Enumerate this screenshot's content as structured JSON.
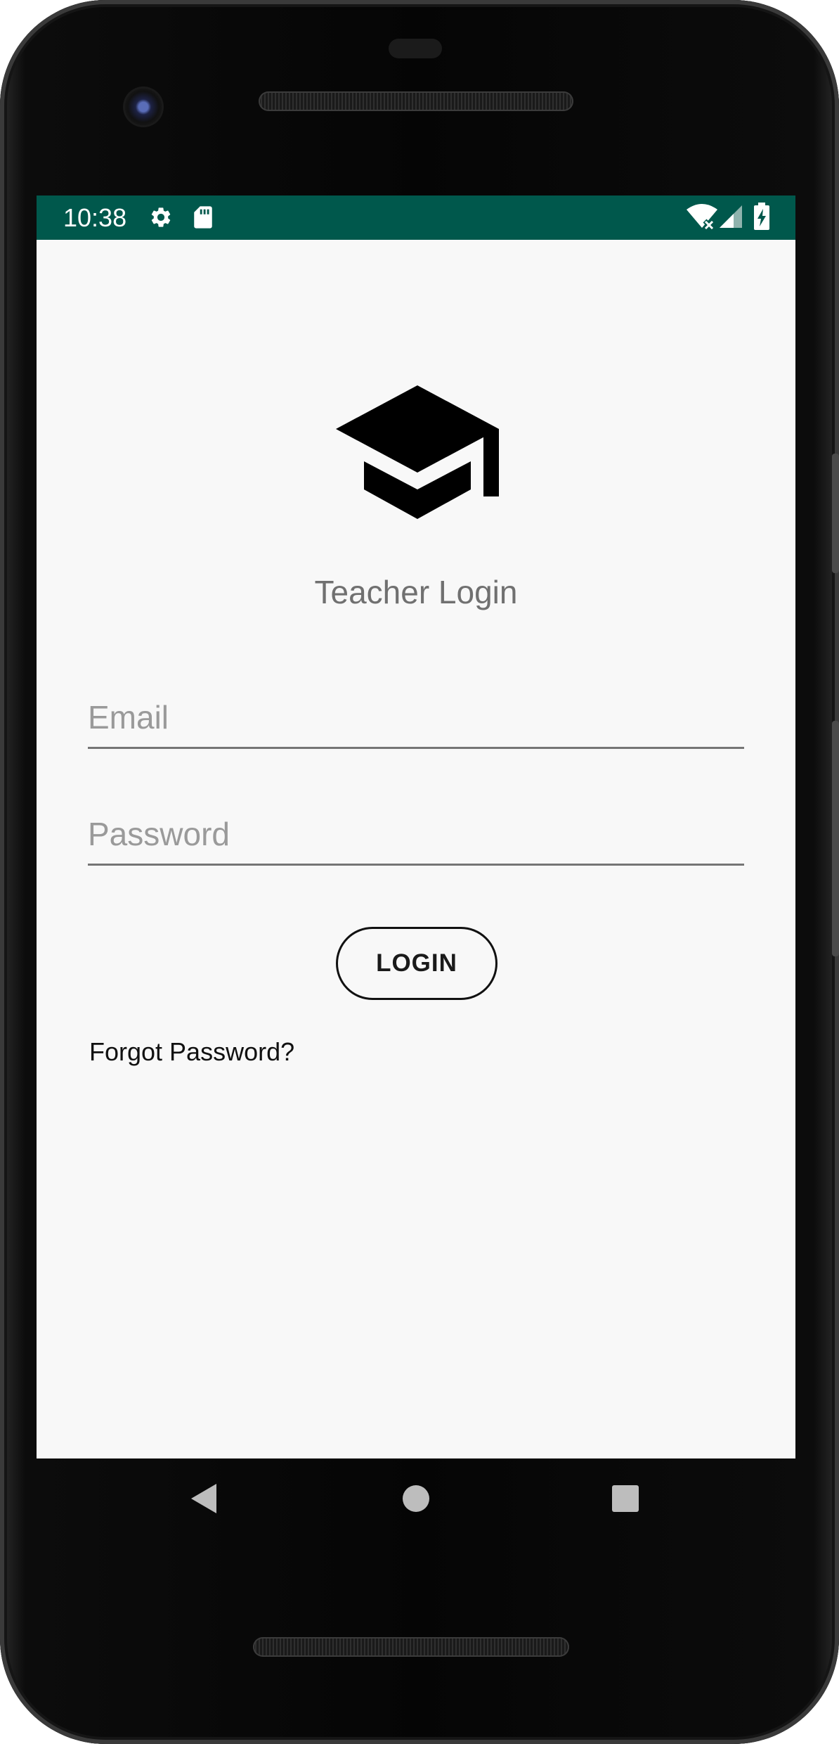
{
  "status_bar": {
    "time": "10:38",
    "background_color": "#00584c",
    "icons": [
      "gear-icon",
      "sd-card-icon",
      "wifi-off-icon",
      "cellular-signal-icon",
      "battery-charging-icon"
    ]
  },
  "app": {
    "logo_icon": "graduation-cap-icon",
    "title": "Teacher Login",
    "email_placeholder": "Email",
    "email_value": "",
    "password_placeholder": "Password",
    "password_value": "",
    "login_label": "LOGIN",
    "forgot_password_label": "Forgot Password?"
  },
  "navigation": {
    "buttons": [
      "back-icon",
      "home-icon",
      "recents-icon"
    ]
  }
}
